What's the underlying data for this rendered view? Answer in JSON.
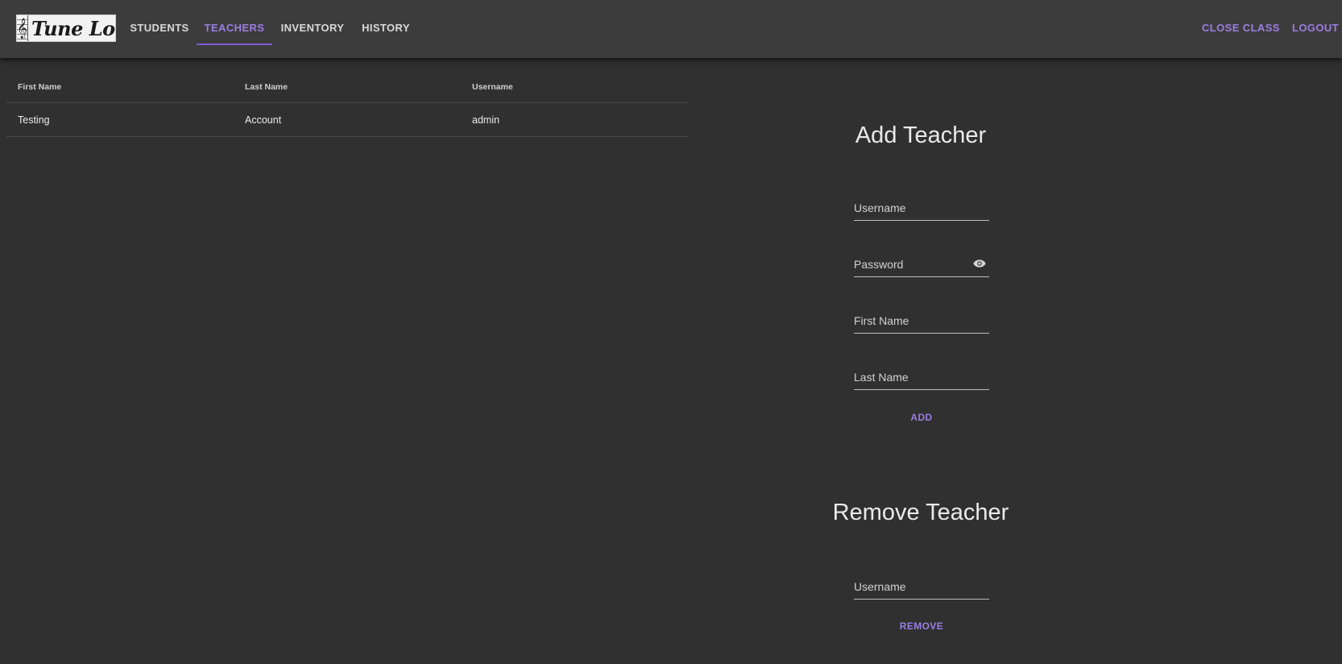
{
  "app": {
    "logo_text": "Tune Log",
    "logo_clef": "𝄞"
  },
  "nav": {
    "tabs": [
      {
        "label": "STUDENTS",
        "active": false
      },
      {
        "label": "TEACHERS",
        "active": true
      },
      {
        "label": "INVENTORY",
        "active": false
      },
      {
        "label": "HISTORY",
        "active": false
      }
    ],
    "close_class": "CLOSE CLASS",
    "logout": "LOGOUT"
  },
  "table": {
    "headers": [
      "First Name",
      "Last Name",
      "Username"
    ],
    "rows": [
      [
        "Testing",
        "Account",
        "admin"
      ]
    ]
  },
  "add_teacher": {
    "title": "Add Teacher",
    "username_placeholder": "Username",
    "password_placeholder": "Password",
    "password_toggle_icon": "eye-icon",
    "first_name_placeholder": "First Name",
    "last_name_placeholder": "Last Name",
    "submit_label": "ADD"
  },
  "remove_teacher": {
    "title": "Remove Teacher",
    "username_placeholder": "Username",
    "submit_label": "REMOVE"
  },
  "colors": {
    "background": "#303030",
    "appbar": "#3c3c3c",
    "accent": "#9a7ee0"
  }
}
